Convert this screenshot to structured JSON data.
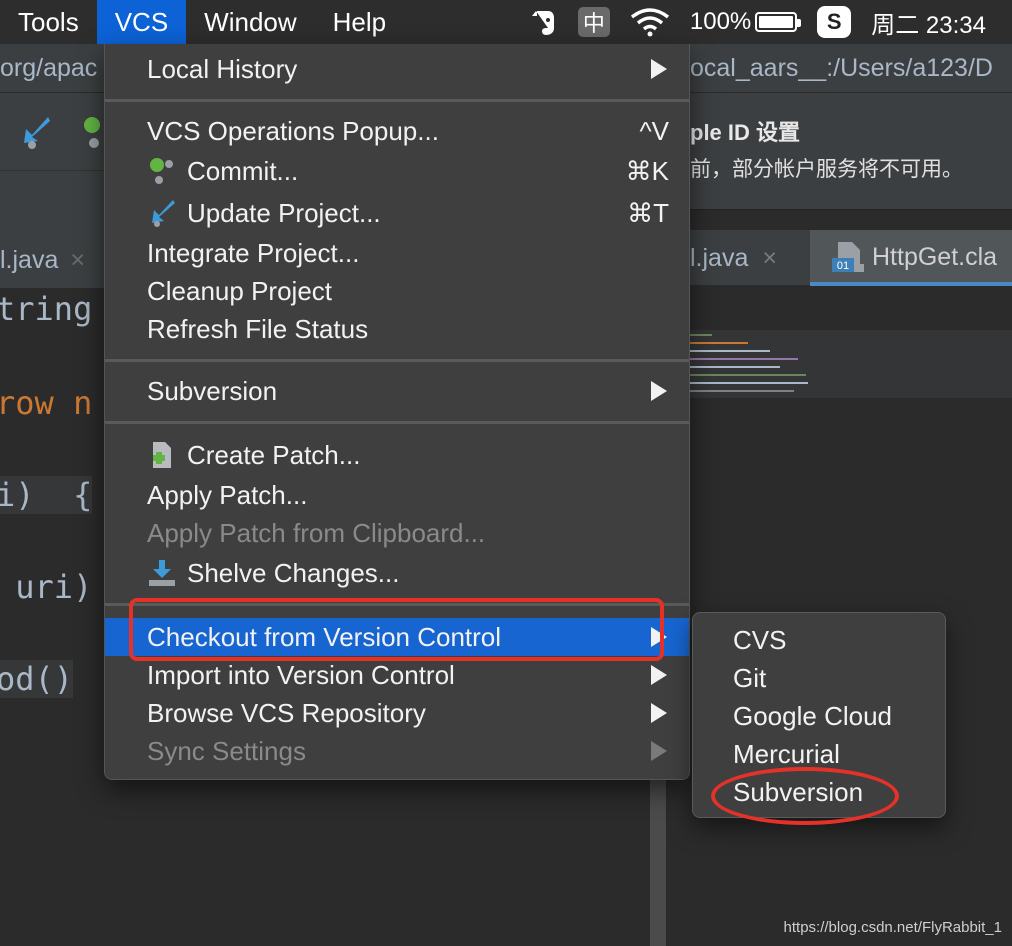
{
  "menubar": {
    "items": [
      "Tools",
      "VCS",
      "Window",
      "Help"
    ],
    "active_index": 1,
    "ime_label": "中",
    "sogou_label": "S",
    "battery_text": "100%",
    "battery_level": 1.0,
    "clock": "周二 23:34"
  },
  "ide_left": {
    "path_text": "org/apac",
    "tab_label": "l.java",
    "tab_close": "×",
    "code_lines": [
      {
        "text": "tring",
        "top": 0
      },
      {
        "text": "row n",
        "kw": true
      },
      {
        "text": "i)  {"
      },
      {
        "text": " uri)"
      },
      {
        "text": "od()"
      }
    ]
  },
  "ide_right": {
    "path_text": "ocal_aars__:/Users/a123/D",
    "notification_title": "ple ID 设置",
    "notification_body": "前，部分帐户服务将不可用。",
    "tab1_label": "l.java",
    "tab1_close": "×",
    "tab2_label": "HttpGet.cla",
    "tab2_icon_text": "01"
  },
  "vcs_menu": {
    "items": [
      {
        "label": "Local History",
        "submenu": true
      },
      {
        "label": "VCS Operations Popup...",
        "shortcut": "^V"
      },
      {
        "label": "Commit...",
        "shortcut": "⌘K",
        "icon": "commit-icon"
      },
      {
        "label": "Update Project...",
        "shortcut": "⌘T",
        "icon": "update-project-icon"
      },
      {
        "label": "Integrate Project..."
      },
      {
        "label": "Cleanup Project"
      },
      {
        "label": "Refresh File Status"
      },
      {
        "label": "Subversion",
        "submenu": true
      },
      {
        "label": "Create Patch...",
        "icon": "create-patch-icon"
      },
      {
        "label": "Apply Patch..."
      },
      {
        "label": "Apply Patch from Clipboard...",
        "disabled": true
      },
      {
        "label": "Shelve Changes...",
        "icon": "shelve-icon"
      },
      {
        "label": "Checkout from Version Control",
        "submenu": true,
        "highlighted": true
      },
      {
        "label": "Import into Version Control",
        "submenu": true
      },
      {
        "label": "Browse VCS Repository",
        "submenu": true
      },
      {
        "label": "Sync Settings",
        "submenu": true,
        "disabled": true
      }
    ]
  },
  "checkout_submenu": {
    "items": [
      "CVS",
      "Git",
      "Google Cloud",
      "Mercurial",
      "Subversion"
    ]
  },
  "watermark": "https://blog.csdn.net/FlyRabbit_1",
  "colors": {
    "menu_highlight": "#1765d1",
    "menubar_active": "#0d62d6",
    "annotation_red": "#e53228"
  }
}
